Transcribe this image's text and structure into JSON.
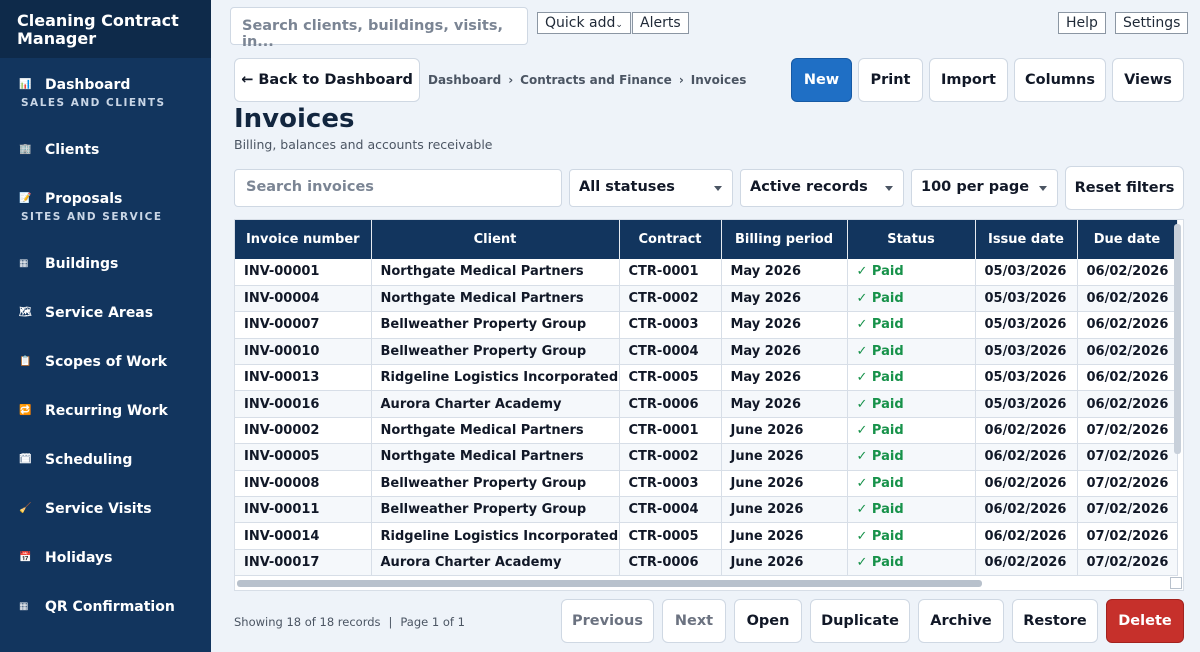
{
  "app": {
    "brand": "Cleaning Contract Manager"
  },
  "sidebar": {
    "items": [
      {
        "type": "item",
        "icon": "dashboard-icon",
        "glyph": "📊",
        "label": "Dashboard"
      },
      {
        "type": "section",
        "label": "SALES AND CLIENTS"
      },
      {
        "type": "item",
        "icon": "clients-icon",
        "glyph": "🏢",
        "label": "Clients"
      },
      {
        "type": "item",
        "icon": "proposals-icon",
        "glyph": "📝",
        "label": "Proposals"
      },
      {
        "type": "section",
        "label": "SITES AND SERVICE"
      },
      {
        "type": "item",
        "icon": "buildings-icon",
        "glyph": "▦",
        "label": "Buildings"
      },
      {
        "type": "item",
        "icon": "map-icon",
        "glyph": "🗺",
        "label": "Service Areas"
      },
      {
        "type": "item",
        "icon": "scope-icon",
        "glyph": "📋",
        "label": "Scopes of Work"
      },
      {
        "type": "item",
        "icon": "recurring-icon",
        "glyph": "🔁",
        "label": "Recurring Work"
      },
      {
        "type": "item",
        "icon": "calendar-icon",
        "glyph": "🗓",
        "label": "Scheduling"
      },
      {
        "type": "item",
        "icon": "broom-icon",
        "glyph": "🧹",
        "label": "Service Visits"
      },
      {
        "type": "item",
        "icon": "holiday-icon",
        "glyph": "📅",
        "label": "Holidays"
      },
      {
        "type": "item",
        "icon": "qr-icon",
        "glyph": "▦",
        "label": "QR Confirmation"
      }
    ]
  },
  "topbar": {
    "search_placeholder": "Search clients, buildings, visits, in...",
    "quick_add": "Quick add",
    "alerts": "Alerts",
    "help": "Help",
    "settings": "Settings"
  },
  "toolbar": {
    "back": "← Back to Dashboard",
    "breadcrumb": [
      "Dashboard",
      "Contracts and Finance",
      "Invoices"
    ],
    "new": "New",
    "print": "Print",
    "import": "Import",
    "columns": "Columns",
    "views": "Views"
  },
  "page": {
    "title": "Invoices",
    "subtitle": "Billing, balances and accounts receivable"
  },
  "filters": {
    "search_placeholder": "Search invoices",
    "status": "All statuses",
    "records": "Active records",
    "per_page": "100 per page",
    "reset": "Reset filters"
  },
  "table": {
    "columns": [
      "Invoice number",
      "Client",
      "Contract",
      "Billing period",
      "Status",
      "Issue date",
      "Due date"
    ],
    "rows": [
      [
        "INV-00001",
        "Northgate Medical Partners",
        "CTR-0001",
        "May 2026",
        "✓ Paid",
        "05/03/2026",
        "06/02/2026"
      ],
      [
        "INV-00004",
        "Northgate Medical Partners",
        "CTR-0002",
        "May 2026",
        "✓ Paid",
        "05/03/2026",
        "06/02/2026"
      ],
      [
        "INV-00007",
        "Bellweather Property Group",
        "CTR-0003",
        "May 2026",
        "✓ Paid",
        "05/03/2026",
        "06/02/2026"
      ],
      [
        "INV-00010",
        "Bellweather Property Group",
        "CTR-0004",
        "May 2026",
        "✓ Paid",
        "05/03/2026",
        "06/02/2026"
      ],
      [
        "INV-00013",
        "Ridgeline Logistics Incorporated",
        "CTR-0005",
        "May 2026",
        "✓ Paid",
        "05/03/2026",
        "06/02/2026"
      ],
      [
        "INV-00016",
        "Aurora Charter Academy",
        "CTR-0006",
        "May 2026",
        "✓ Paid",
        "05/03/2026",
        "06/02/2026"
      ],
      [
        "INV-00002",
        "Northgate Medical Partners",
        "CTR-0001",
        "June 2026",
        "✓ Paid",
        "06/02/2026",
        "07/02/2026"
      ],
      [
        "INV-00005",
        "Northgate Medical Partners",
        "CTR-0002",
        "June 2026",
        "✓ Paid",
        "06/02/2026",
        "07/02/2026"
      ],
      [
        "INV-00008",
        "Bellweather Property Group",
        "CTR-0003",
        "June 2026",
        "✓ Paid",
        "06/02/2026",
        "07/02/2026"
      ],
      [
        "INV-00011",
        "Bellweather Property Group",
        "CTR-0004",
        "June 2026",
        "✓ Paid",
        "06/02/2026",
        "07/02/2026"
      ],
      [
        "INV-00014",
        "Ridgeline Logistics Incorporated",
        "CTR-0005",
        "June 2026",
        "✓ Paid",
        "06/02/2026",
        "07/02/2026"
      ],
      [
        "INV-00017",
        "Aurora Charter Academy",
        "CTR-0006",
        "June 2026",
        "✓ Paid",
        "06/02/2026",
        "07/02/2026"
      ]
    ]
  },
  "footer": {
    "showing": "Showing 18 of 18 records",
    "page": "Page 1 of 1",
    "previous": "Previous",
    "next": "Next",
    "open": "Open",
    "duplicate": "Duplicate",
    "archive": "Archive",
    "restore": "Restore",
    "delete": "Delete"
  },
  "colors": {
    "sidebar": "#12355e",
    "primary": "#1f6fc5",
    "danger": "#c6302b",
    "paid": "#17924a"
  }
}
